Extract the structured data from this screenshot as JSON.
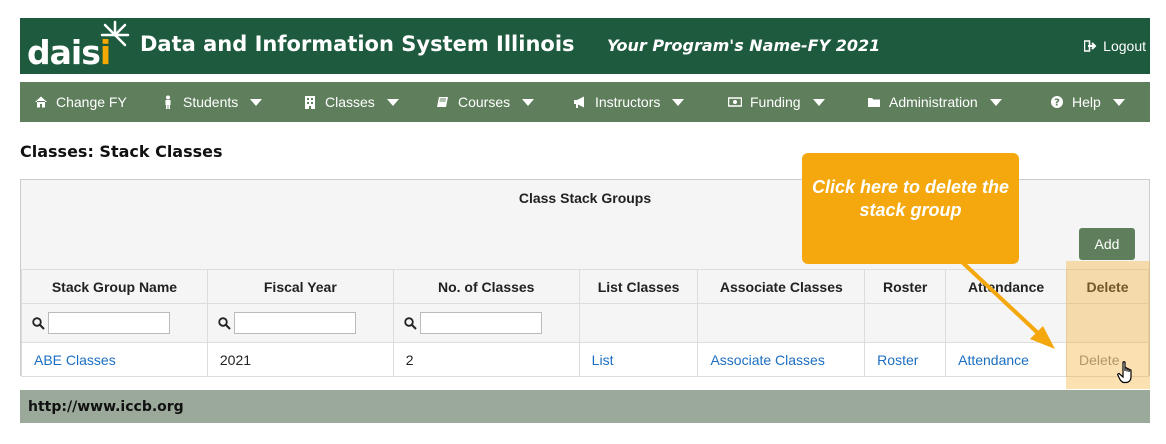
{
  "header": {
    "logo_text": "dais",
    "logo_accent": "i",
    "app_title": "Data and Information System Illinois",
    "program_name": "Your Program's Name-FY 2021",
    "logout_label": "Logout"
  },
  "nav": {
    "items": [
      {
        "label": "Change FY",
        "icon": "home-icon"
      },
      {
        "label": "Students",
        "icon": "person-icon"
      },
      {
        "label": "Classes",
        "icon": "building-icon"
      },
      {
        "label": "Courses",
        "icon": "book-icon"
      },
      {
        "label": "Instructors",
        "icon": "bullhorn-icon"
      },
      {
        "label": "Funding",
        "icon": "money-icon"
      },
      {
        "label": "Administration",
        "icon": "folder-icon"
      },
      {
        "label": "Help",
        "icon": "question-icon"
      }
    ]
  },
  "page_title": "Classes: Stack Classes",
  "panel": {
    "title": "Class Stack Groups",
    "add_label": "Add"
  },
  "table": {
    "columns": [
      "Stack Group Name",
      "Fiscal Year",
      "No. of Classes",
      "List Classes",
      "Associate Classes",
      "Roster",
      "Attendance",
      "Delete"
    ],
    "rows": [
      {
        "name": "ABE Classes",
        "fiscal_year": "2021",
        "num_classes": "2",
        "list": "List",
        "associate": "Associate Classes",
        "roster": "Roster",
        "attendance": "Attendance",
        "delete": "Delete"
      }
    ]
  },
  "callout": {
    "text": "Click here to delete the stack group"
  },
  "footer": {
    "url": "http://www.iccb.org"
  },
  "colors": {
    "header_bg": "#1e5a3e",
    "nav_bg": "#5f7f5c",
    "callout_bg": "#f5a80d",
    "link": "#1b6ec2",
    "footer_bg": "#9aa99a"
  }
}
